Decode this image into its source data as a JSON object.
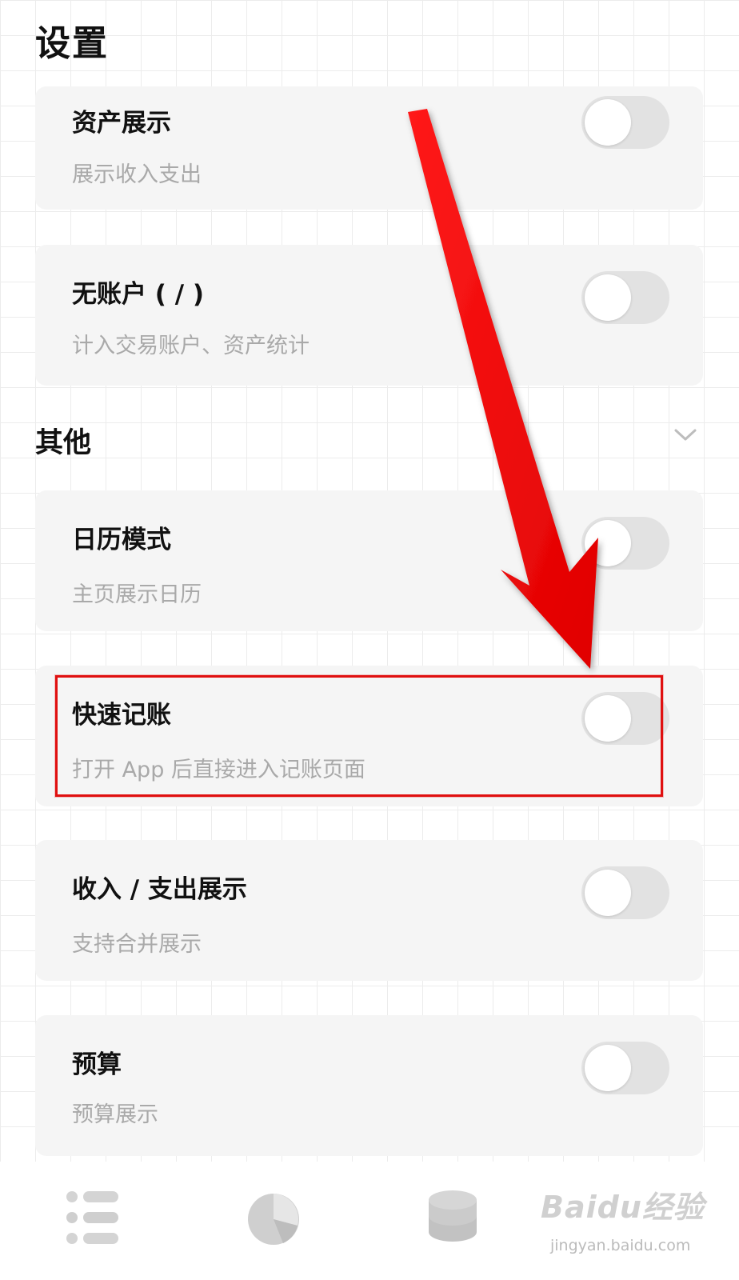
{
  "header": {
    "title": "设置"
  },
  "settings_top": [
    {
      "title": "资产展示",
      "subtitle": "展示收入支出",
      "enabled": false
    },
    {
      "title": "无账户 ( / )",
      "subtitle": "计入交易账户、资产统计",
      "enabled": false
    }
  ],
  "section_other": {
    "title": "其他",
    "items": [
      {
        "title": "日历模式",
        "subtitle": "主页展示日历",
        "enabled": false
      },
      {
        "title": "快速记账",
        "subtitle": "打开 App 后直接进入记账页面",
        "enabled": false
      },
      {
        "title": "收入 / 支出展示",
        "subtitle": "支持合并展示",
        "enabled": false
      },
      {
        "title": "预算",
        "subtitle": "预算展示",
        "enabled": false
      }
    ]
  },
  "tabs": [
    {
      "icon": "list-icon"
    },
    {
      "icon": "pie-chart-icon"
    },
    {
      "icon": "coin-stack-icon"
    }
  ],
  "watermark": {
    "logo": "Baidu经验",
    "url": "jingyan.baidu.com"
  },
  "colors": {
    "card_bg": "#f5f5f5",
    "toggle_off": "#e2e2e2",
    "subtitle": "#a9a9a9",
    "annotation_red": "#e01010"
  }
}
